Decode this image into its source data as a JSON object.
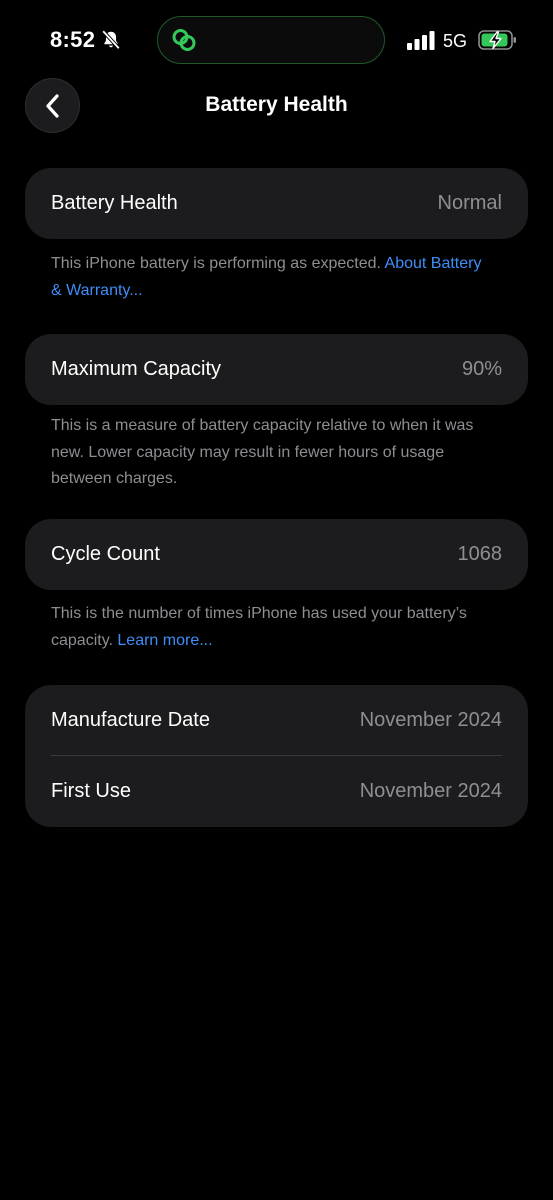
{
  "status_bar": {
    "time": "8:52",
    "network": "5G"
  },
  "nav": {
    "title": "Battery Health"
  },
  "battery_health": {
    "label": "Battery Health",
    "value": "Normal",
    "footnote": "This iPhone battery is performing as expected. ",
    "footnote_link": "About Battery & Warranty..."
  },
  "max_capacity": {
    "label": "Maximum Capacity",
    "value": "90%",
    "footnote": "This is a measure of battery capacity relative to when it was new. Lower capacity may result in fewer hours of usage between charges."
  },
  "cycle_count": {
    "label": "Cycle Count",
    "value": "1068",
    "footnote": "This is the number of times iPhone has used your battery’s capacity. ",
    "footnote_link": "Learn more..."
  },
  "dates": {
    "manufacture_label": "Manufacture Date",
    "manufacture_value": "November 2024",
    "first_use_label": "First Use",
    "first_use_value": "November 2024"
  },
  "colors": {
    "background": "#000000",
    "card": "#1c1c1e",
    "secondary_text": "#8e8e93",
    "link": "#3e8ef7",
    "charging_green": "#34c759"
  },
  "icons": {
    "back": "chevron-left-icon",
    "silent": "bell-slash-icon",
    "island_activity": "link-icon",
    "signal": "cellular-signal-icon",
    "battery": "battery-charging-icon"
  }
}
